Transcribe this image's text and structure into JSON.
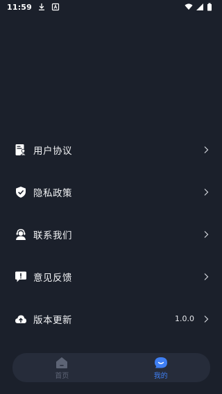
{
  "status_bar": {
    "time": "11:59",
    "icons": [
      "download-icon",
      "a-box-icon",
      "wifi-icon",
      "signal-icon",
      "battery-icon"
    ]
  },
  "menu": {
    "items": [
      {
        "label": "用户协议",
        "icon": "user-agreement-icon",
        "value": ""
      },
      {
        "label": "隐私政策",
        "icon": "shield-check-icon",
        "value": ""
      },
      {
        "label": "联系我们",
        "icon": "customer-service-icon",
        "value": ""
      },
      {
        "label": "意见反馈",
        "icon": "feedback-icon",
        "value": ""
      },
      {
        "label": "版本更新",
        "icon": "cloud-upload-icon",
        "value": "1.0.0"
      }
    ]
  },
  "tabbar": {
    "tabs": [
      {
        "label": "首页",
        "icon": "home-icon",
        "active": false
      },
      {
        "label": "我的",
        "icon": "profile-bubble-icon",
        "active": true
      }
    ]
  },
  "colors": {
    "background": "#1b202b",
    "tabbar_bg": "#262c3a",
    "accent": "#3f7ff3",
    "inactive": "#5d6475",
    "text": "#f2f3f5"
  }
}
